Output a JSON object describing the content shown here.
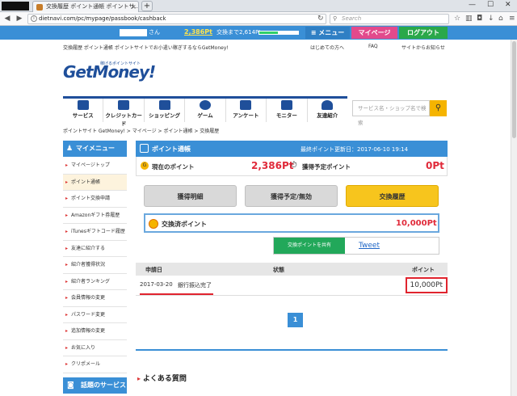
{
  "browser": {
    "tab_title": "交換履歴 ポイント通帳 ポイントサ...",
    "tab_close": "×",
    "new_tab": "+",
    "url": "dietnavi.com/pc/mypage/passbook/cashback",
    "search_placeholder": "Search",
    "window_controls": [
      "—",
      "☐",
      "✕"
    ]
  },
  "userbar": {
    "suffix": "さん",
    "points": "2,386Pt",
    "next_text": "交換まで2,614Pt",
    "progress_fraction": 0.48,
    "menu_label": "≡ メニュー",
    "mypage_label": "マイページ",
    "logout_label": "ログアウト"
  },
  "header": {
    "tagline": "交換履歴 ポイント通帳 ポイントサイトでお小遣い稼ぎするならGetMoney!",
    "links": [
      "はじめての方へ",
      "FAQ",
      "サイトからお知らせ"
    ],
    "logo_text": "GetMoney!",
    "logo_sub": "稼げるポイントサイト"
  },
  "gnav": [
    {
      "label": "サービス",
      "icon": "service-icon"
    },
    {
      "label": "クレジットカード",
      "icon": "credit-card-icon"
    },
    {
      "label": "ショッピング",
      "icon": "cart-icon"
    },
    {
      "label": "ゲーム",
      "icon": "game-icon"
    },
    {
      "label": "アンケート",
      "icon": "survey-icon"
    },
    {
      "label": "モニター",
      "icon": "monitor-icon"
    },
    {
      "label": "友達紹介",
      "icon": "friend-icon"
    }
  ],
  "site_search": {
    "placeholder": "サービス名・ショップ名で検索"
  },
  "breadcrumb": "ポイントサイト GetMoney! > マイページ > ポイント通帳 > 交換履歴",
  "sidebar": {
    "title": "マイメニュー",
    "items": [
      "マイページトップ",
      "ポイント通帳",
      "ポイント交換申請",
      "Amazonギフト券履歴",
      "iTunesギフトコード履歴",
      "友達に紹介する",
      "紹介者獲得状況",
      "紹介者ランキング",
      "会員情報の変更",
      "パスワード変更",
      "追加情報の変更",
      "お気に入り",
      "クリポメール"
    ],
    "active_index": 1,
    "title2": "話題のサービス"
  },
  "main": {
    "title": "ポイント通帳",
    "updated": "最終ポイント更新日：2017-06-10 19:14",
    "current_label": "現在のポイント",
    "current_value": "2,386Pt",
    "pending_label": "獲得予定ポイント",
    "pending_value": "0Pt",
    "tabs": [
      "獲得明細",
      "獲得予定/無効",
      "交換履歴"
    ],
    "exchanged_label": "交換済ポイント",
    "exchanged_value": "10,000Pt",
    "share_label": "交換ポイントを共有",
    "tweet_label": "Tweet",
    "table": {
      "headers": [
        "申請日",
        "状態",
        "ポイント"
      ],
      "rows": [
        {
          "date": "2017-03-20",
          "status": "銀行振込完了",
          "points": "10,000Pt"
        }
      ]
    },
    "page": "1",
    "faq_title": "よくある質問"
  }
}
